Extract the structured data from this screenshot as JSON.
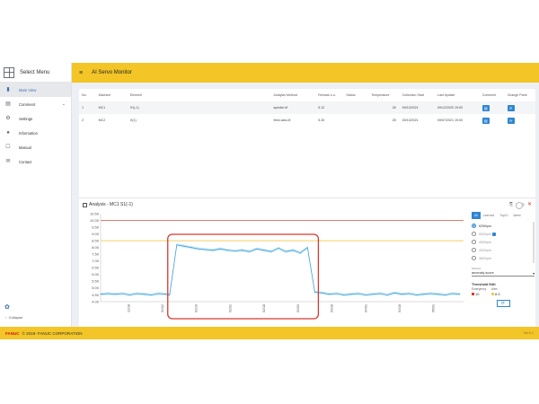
{
  "sidebar": {
    "title": "Select Menu",
    "items": [
      {
        "label": "Main View",
        "icon": "bar-chart-icon",
        "active": true
      },
      {
        "label": "Comment",
        "icon": "comment-icon",
        "expandable": true
      },
      {
        "label": "Settings",
        "icon": "gear-icon"
      },
      {
        "label": "Information",
        "icon": "info-icon"
      },
      {
        "label": "Manual",
        "icon": "manual-icon"
      },
      {
        "label": "Contact",
        "icon": "mail-icon"
      }
    ],
    "collapse_label": "Collapse"
  },
  "header": {
    "title": "AI Servo Monitor"
  },
  "table": {
    "columns": [
      "No.",
      "Machine",
      "Element",
      "Analysis Method",
      "Remark u.u.",
      "Status",
      "Temperature",
      "Collection Start",
      "Last Update",
      "Comment",
      "Change Parts"
    ],
    "rows": [
      {
        "no": "1",
        "machine": "MC1",
        "element": "S1(-1)",
        "method": "spindle-M",
        "remark": "5.12",
        "status": "",
        "temperature": "28",
        "start": "09/13/2021",
        "update": "09/12/2020 19:00"
      },
      {
        "no": "2",
        "machine": "MC2",
        "element": "X(1)",
        "method": "feed-axis-M",
        "remark": "5.30",
        "status": "",
        "temperature": "28",
        "start": "09/13/2021",
        "update": "09/07/2021 19:00"
      }
    ]
  },
  "chart_panel": {
    "title": "Analysis - MC1 S1(-1)",
    "tabs": [
      "All",
      "Learned",
      "Top10",
      "latest"
    ],
    "speed_options": [
      "6250rpm",
      "5000rpm",
      "4500rpm",
      "4000rpm",
      "3800rpm"
    ],
    "selected_speed": "6250rpm",
    "method_label": "Method",
    "method_value": "anomaly score",
    "threshold_title": "Threshold Edit",
    "emergency_label": "Emergency",
    "alert_label": "Alert",
    "emergency_value": "10",
    "alert_value": "8.5"
  },
  "chart_data": {
    "type": "line",
    "title": "",
    "xlabel": "",
    "ylabel": "",
    "ylim": [
      4.0,
      10.5
    ],
    "yticks": [
      "10.50",
      "10.00",
      "9.50",
      "9.00",
      "8.50",
      "8.00",
      "7.50",
      "7.00",
      "6.50",
      "6.00",
      "5.50",
      "5.00",
      "4.50",
      "4.00"
    ],
    "x_tick_labels": [
      "12/18",
      "01/02",
      "01/10",
      "02/02",
      "02/18",
      "03/03",
      "03/18",
      "04/01",
      "04/18",
      "05/01"
    ],
    "thresholds": [
      {
        "name": "Emergency",
        "value": 10,
        "color": "#e0685a"
      },
      {
        "name": "Alert",
        "value": 8.5,
        "color": "#f0c030"
      }
    ],
    "series": [
      {
        "color": "#3aa0d8",
        "x": [
          0,
          2,
          4,
          6,
          8,
          10,
          12,
          14,
          16,
          18,
          19,
          21,
          23,
          25,
          27,
          29,
          31,
          33,
          35,
          37,
          39,
          41,
          43,
          45,
          47,
          49,
          51,
          53,
          55,
          57,
          59,
          61,
          63,
          65,
          67,
          69,
          71,
          73,
          75,
          77,
          79,
          81,
          83,
          85,
          87,
          89,
          91,
          93,
          95,
          97,
          99
        ],
        "values": [
          4.55,
          4.6,
          4.55,
          4.6,
          4.5,
          4.6,
          4.55,
          4.5,
          4.6,
          4.55,
          4.5,
          8.2,
          8.1,
          8.0,
          7.9,
          7.85,
          7.8,
          7.9,
          7.8,
          7.75,
          7.8,
          7.7,
          7.9,
          7.8,
          7.7,
          7.95,
          7.7,
          7.8,
          7.6,
          8.0,
          4.7,
          4.65,
          4.55,
          4.6,
          4.5,
          4.55,
          4.6,
          4.5,
          4.55,
          4.6,
          4.5,
          4.65,
          4.55,
          4.6,
          4.5,
          4.55,
          4.6,
          4.55,
          4.5,
          4.6,
          4.55
        ]
      }
    ],
    "highlight_region": [
      18.5,
      60
    ]
  },
  "footer": {
    "brand": "FANUC",
    "copyright": "© 2019- FANUC CORPORATION",
    "version": "Ver.0.1"
  },
  "colors": {
    "accent": "#f3c526",
    "primary": "#2e86d1",
    "highlight": "#d9382f"
  }
}
